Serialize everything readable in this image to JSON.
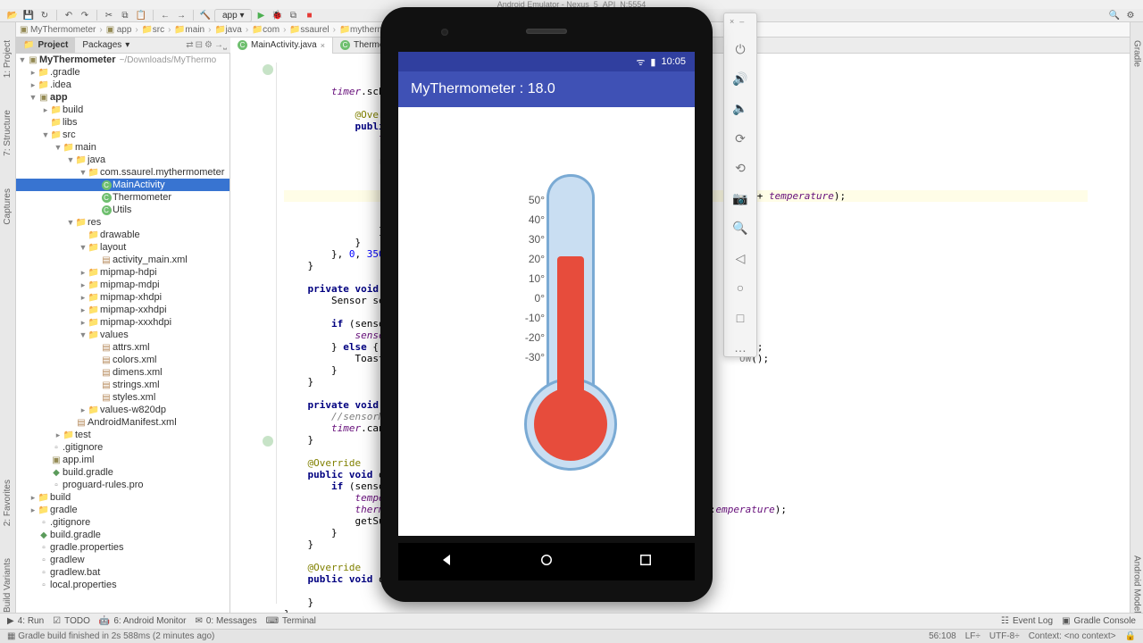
{
  "emulator_title": "Android Emulator - Nexus_5_API_N:5554",
  "toolbar": {
    "run_config": "app ▾"
  },
  "breadcrumbs": [
    "MyThermometer",
    "app",
    "src",
    "main",
    "java",
    "com",
    "ssaurel",
    "mythermometer"
  ],
  "project_tabs": {
    "active": "Project",
    "other": "Packages"
  },
  "left_vertical": [
    "1: Project",
    "7: Structure",
    "Captures"
  ],
  "right_vertical": [
    "Gradle",
    "Android Model"
  ],
  "tree_root": {
    "label": "MyThermometer",
    "hint": "~/Downloads/MyThermo"
  },
  "tree": {
    "gradle_dir": ".gradle",
    "idea_dir": ".idea",
    "app": "app",
    "build": "build",
    "libs": "libs",
    "src": "src",
    "main": "main",
    "java_dir": "java",
    "pkg": "com.ssaurel.mythermometer",
    "main_activity": "MainActivity",
    "thermometer": "Thermometer",
    "utils": "Utils",
    "res": "res",
    "drawable": "drawable",
    "layout": "layout",
    "activity_main": "activity_main.xml",
    "mipmap_hdpi": "mipmap-hdpi",
    "mipmap_mdpi": "mipmap-mdpi",
    "mipmap_xhdpi": "mipmap-xhdpi",
    "mipmap_xxhdpi": "mipmap-xxhdpi",
    "mipmap_xxxhdpi": "mipmap-xxxhdpi",
    "values": "values",
    "attrs": "attrs.xml",
    "colors": "colors.xml",
    "dimens": "dimens.xml",
    "strings": "strings.xml",
    "styles": "styles.xml",
    "values_w": "values-w820dp",
    "manifest": "AndroidManifest.xml",
    "test": "test",
    "gitignore": ".gitignore",
    "app_iml": "app.iml",
    "build_gradle": "build.gradle",
    "proguard": "proguard-rules.pro",
    "build_top": "build",
    "gradle_top": "gradle",
    "gitignore_top": ".gitignore",
    "build_gradle_top": "build.gradle",
    "gradle_props": "gradle.properties",
    "gradlew": "gradlew",
    "gradlew_bat": "gradlew.bat",
    "local_props": "local.properties"
  },
  "editor_tabs": {
    "active": "MainActivity.java",
    "other": "Thermom"
  },
  "emu_sidebar": {
    "power": "⏻",
    "volup": "🔊",
    "voldown": "🔈",
    "rotl": "⟳",
    "rotr": "⟲",
    "camera": "📷",
    "zoom": "🔍",
    "back": "◁",
    "home": "○",
    "recents": "□",
    "more": "…"
  },
  "android": {
    "status_signal": "ᯤ",
    "status_battery": "▮",
    "status_time": "10:05",
    "app_title": "MyThermometer : 18.0",
    "ticks": [
      "50°",
      "40°",
      "30°",
      "20°",
      "10°",
      "0°",
      "-10°",
      "-20°",
      "-30°"
    ]
  },
  "bottom_tools": {
    "run": "4: Run",
    "todo": "TODO",
    "android": "6: Android Monitor",
    "messages": "0: Messages",
    "terminal": "Terminal",
    "eventlog": "Event Log",
    "gradle": "Gradle Console"
  },
  "statusbar": {
    "msg": "Gradle build finished in 2s 588ms (2 minutes ago)",
    "pos": "56:108",
    "lf": "LF÷",
    "enc": "UTF-8÷",
    "context": "Context: <no context>"
  },
  "favorites_label": "2: Favorites",
  "build_variants_label": "Build Variants"
}
